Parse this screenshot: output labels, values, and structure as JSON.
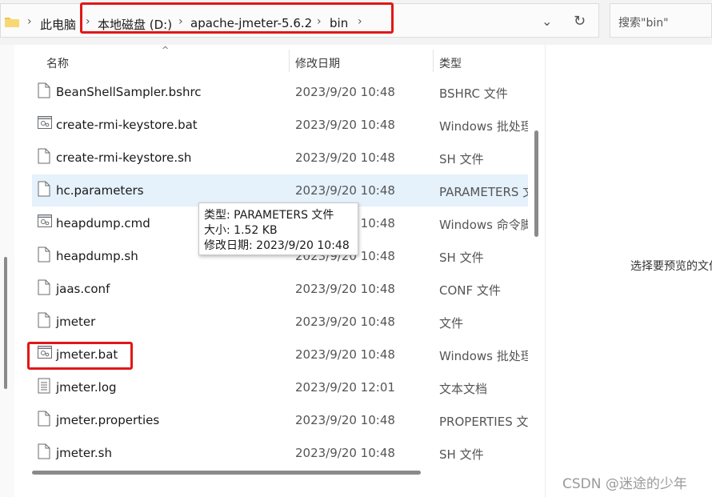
{
  "address": {
    "crumbs": [
      "此电脑",
      "本地磁盘 (D:)",
      "apache-jmeter-5.6.2",
      "bin"
    ],
    "search_placeholder": "搜索\"bin\""
  },
  "columns": {
    "name": "名称",
    "modified": "修改日期",
    "type": "类型"
  },
  "files": [
    {
      "name": "BeanShellSampler.bshrc",
      "date": "2023/9/20 10:48",
      "type": "BSHRC 文件",
      "icon": "file-icon"
    },
    {
      "name": "create-rmi-keystore.bat",
      "date": "2023/9/20 10:48",
      "type": "Windows 批处理",
      "icon": "batch-file-icon"
    },
    {
      "name": "create-rmi-keystore.sh",
      "date": "2023/9/20 10:48",
      "type": "SH 文件",
      "icon": "file-icon"
    },
    {
      "name": "hc.parameters",
      "date": "2023/9/20 10:48",
      "type": "PARAMETERS 文",
      "icon": "file-icon"
    },
    {
      "name": "heapdump.cmd",
      "date": "2023/9/20 10:48",
      "type": "Windows 命令脚",
      "icon": "batch-file-icon"
    },
    {
      "name": "heapdump.sh",
      "date": "2023/9/20 10:48",
      "type": "SH 文件",
      "icon": "file-icon"
    },
    {
      "name": "jaas.conf",
      "date": "2023/9/20 10:48",
      "type": "CONF 文件",
      "icon": "file-icon"
    },
    {
      "name": "jmeter",
      "date": "2023/9/20 10:48",
      "type": "文件",
      "icon": "file-icon"
    },
    {
      "name": "jmeter.bat",
      "date": "2023/9/20 10:48",
      "type": "Windows 批处理",
      "icon": "batch-file-icon"
    },
    {
      "name": "jmeter.log",
      "date": "2023/9/20 12:01",
      "type": "文本文档",
      "icon": "text-file-icon"
    },
    {
      "name": "jmeter.properties",
      "date": "2023/9/20 10:48",
      "type": "PROPERTIES 文件",
      "icon": "file-icon"
    },
    {
      "name": "jmeter.sh",
      "date": "2023/9/20 10:48",
      "type": "SH 文件",
      "icon": "file-icon"
    }
  ],
  "tooltip": {
    "type": "类型: PARAMETERS 文件",
    "size": "大小: 1.52 KB",
    "modified": "修改日期: 2023/9/20 10:48"
  },
  "preview_text": "选择要预览的文件",
  "watermark": "CSDN @迷途的少年",
  "colors": {
    "highlight": "#e01818",
    "selected_row": "#e5f1fb"
  }
}
